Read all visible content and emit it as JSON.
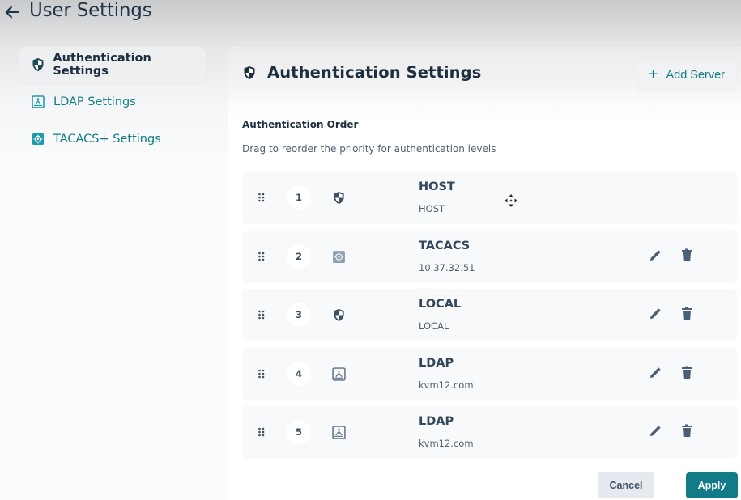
{
  "header": {
    "title": "User Settings",
    "back_icon": "arrow-left-icon"
  },
  "sidebar": {
    "items": [
      {
        "label": "Authentication Settings",
        "icon": "shield-icon",
        "active": true
      },
      {
        "label": "LDAP Settings",
        "icon": "ldap-icon",
        "active": false
      },
      {
        "label": "TACACS+ Settings",
        "icon": "tacacs-icon",
        "active": false
      }
    ]
  },
  "panel": {
    "title": "Authentication Settings",
    "title_icon": "shield-icon",
    "add_server_label": "Add Server",
    "add_server_icon": "plus-icon",
    "section_label": "Authentication Order",
    "section_desc": "Drag to reorder the priority for authentication levels",
    "methods": [
      {
        "order": "1",
        "type": "HOST",
        "detail": "HOST",
        "icon": "shield-icon",
        "editable": false
      },
      {
        "order": "2",
        "type": "TACACS",
        "detail": "10.37.32.51",
        "icon": "tacacs-icon",
        "editable": true
      },
      {
        "order": "3",
        "type": "LOCAL",
        "detail": "LOCAL",
        "icon": "shield-icon",
        "editable": true
      },
      {
        "order": "4",
        "type": "LDAP",
        "detail": "kvm12.com",
        "icon": "ldap-icon",
        "editable": true
      },
      {
        "order": "5",
        "type": "LDAP",
        "detail": "kvm12.com",
        "icon": "ldap-icon",
        "editable": true
      }
    ]
  },
  "footer": {
    "cancel_label": "Cancel",
    "apply_label": "Apply"
  },
  "colors": {
    "accent": "#137a87",
    "text_dark": "#1c2e40",
    "icon_gray": "#4a5f75"
  }
}
